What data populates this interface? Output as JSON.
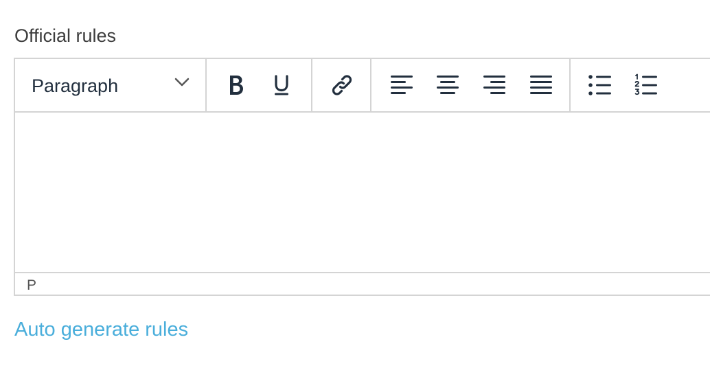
{
  "field": {
    "label": "Official rules"
  },
  "editor": {
    "format_select": {
      "selected": "Paragraph"
    },
    "toolbar_icons": [
      "bold-icon",
      "underline-icon",
      "link-icon",
      "align-left-icon",
      "align-center-icon",
      "align-right-icon",
      "align-justify-icon",
      "bullet-list-icon",
      "numbered-list-icon"
    ],
    "content": "",
    "status_path": "P"
  },
  "links": {
    "auto_generate": "Auto generate rules"
  },
  "colors": {
    "icon": "#222f3e",
    "border": "#d4d4d4",
    "link": "#4aaedb",
    "label": "#3d3d3d"
  }
}
